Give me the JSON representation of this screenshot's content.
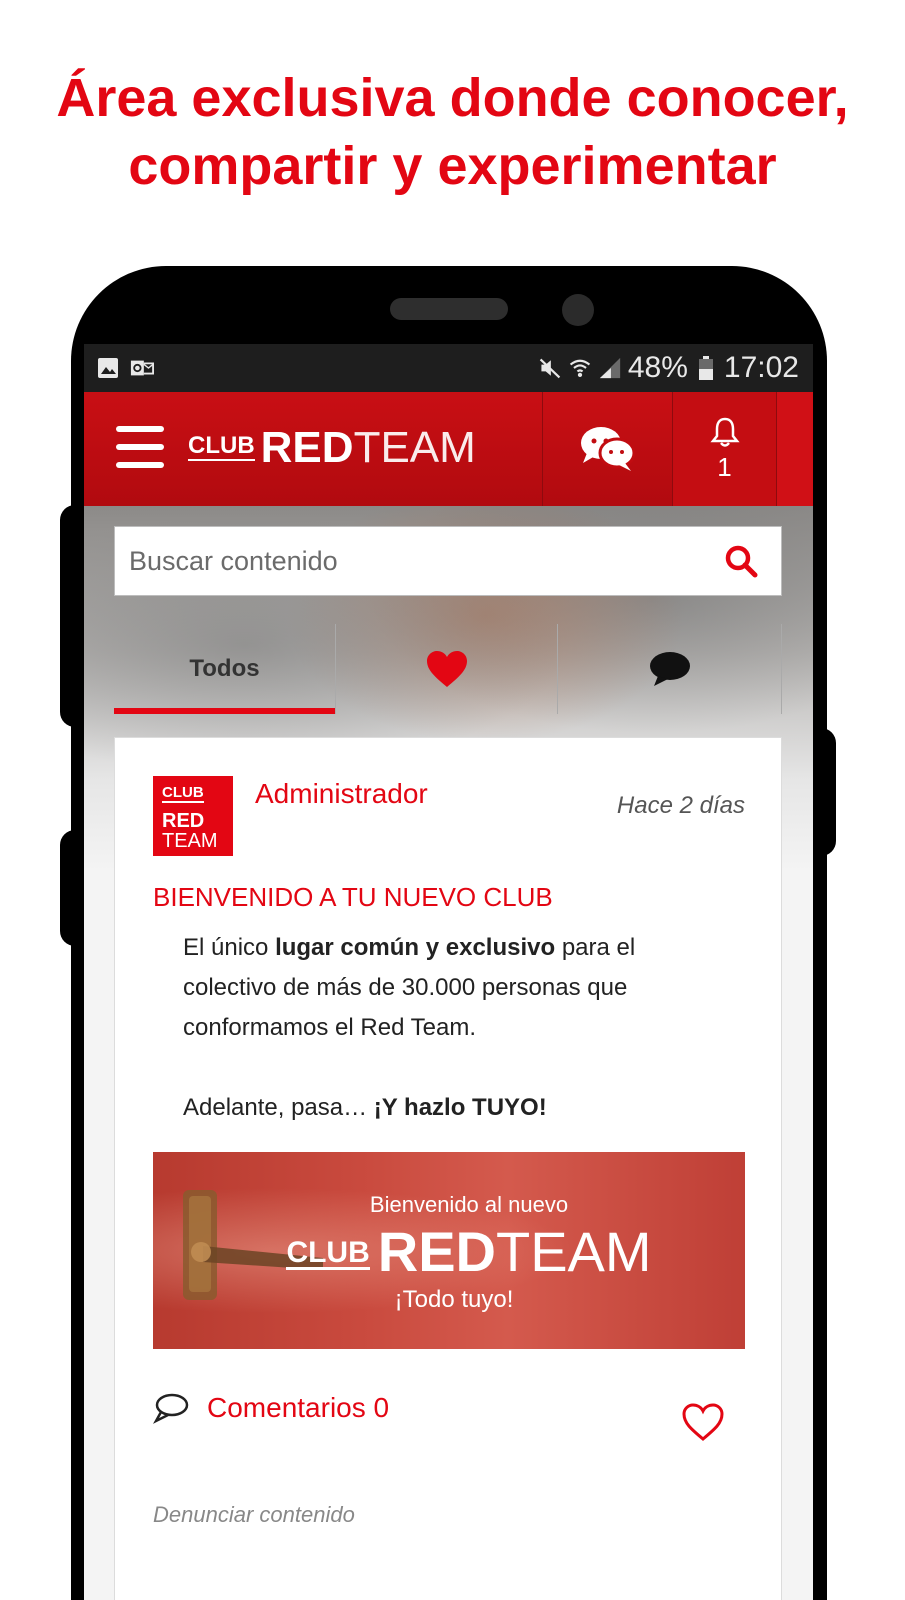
{
  "promo": {
    "line1": "Área exclusiva donde conocer,",
    "line2": "compartir y experimentar"
  },
  "status_bar": {
    "battery": "48%",
    "time": "17:02",
    "icons": [
      "image-icon",
      "outlook-icon",
      "mute-icon",
      "wifi-icon",
      "signal-icon",
      "battery-icon"
    ]
  },
  "header": {
    "logo_club": "CLUB",
    "logo_red": "RED",
    "logo_team": "TEAM",
    "notification_count": "1",
    "accent": "#e30613"
  },
  "search": {
    "placeholder": "Buscar contenido"
  },
  "tabs": [
    {
      "label": "Todos",
      "active": true
    },
    {
      "icon": "heart-icon"
    },
    {
      "icon": "speech-bubble-icon"
    }
  ],
  "post": {
    "avatar": {
      "club": "CLUB",
      "red": "RED",
      "team": "TEAM"
    },
    "author": "Administrador",
    "time": "Hace 2 días",
    "title": "BIENVENIDO A TU NUEVO CLUB",
    "body": {
      "p1_pre": "El único ",
      "p1_bold": "lugar común  y exclusivo",
      "p1_post": " para el colectivo de más de 30.000 personas que conformamos el Red Team.",
      "p2_pre": "Adelante, pasa… ",
      "p2_bold": "¡Y hazlo TUYO!"
    },
    "banner": {
      "line1": "Bienvenido al nuevo",
      "club": "CLUB",
      "red": "RED",
      "team": "TEAM",
      "line3": "¡Todo tuyo!"
    },
    "comments_label": "Comentarios 0",
    "report_label": "Denunciar contenido"
  }
}
